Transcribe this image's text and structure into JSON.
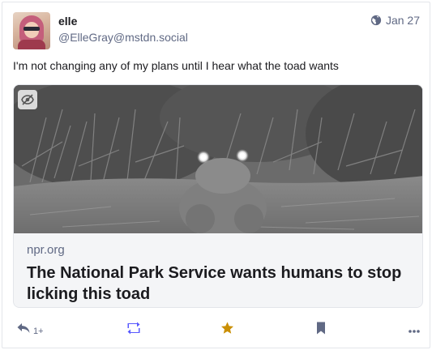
{
  "post": {
    "author": {
      "display_name": "elle",
      "handle": "@ElleGray@mstdn.social"
    },
    "visibility_icon": "globe-icon",
    "date": "Jan 27",
    "text": "I'm not changing any of my plans until I hear what the toad wants"
  },
  "card": {
    "host": "npr.org",
    "title": "The National Park Service wants humans to stop licking this toad",
    "image_icon": "eye-slash-icon"
  },
  "actions": {
    "reply_count": "1+",
    "reply_icon": "reply-icon",
    "boost_icon": "retweet-icon",
    "favourite_icon": "star-icon",
    "bookmark_icon": "bookmark-icon",
    "more_icon": "ellipsis-icon"
  },
  "colors": {
    "text": "#1b1b1f",
    "muted": "#606984",
    "boost": "#595aff",
    "favourite": "#ca8f04"
  }
}
